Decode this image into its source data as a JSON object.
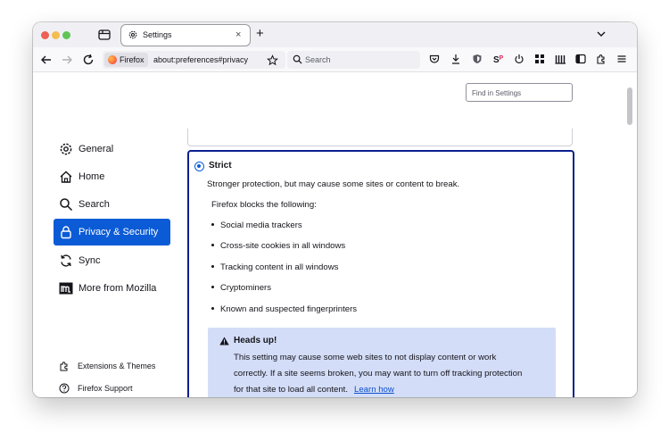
{
  "tab": {
    "title": "Settings",
    "close": "×"
  },
  "newtab_label": "+",
  "urlbar": {
    "identity": "Firefox",
    "url": "about:preferences#privacy"
  },
  "searchbar": {
    "placeholder": "Search"
  },
  "find": {
    "placeholder": "Find in Settings"
  },
  "sidebar": {
    "items": [
      {
        "label": "General",
        "icon": "gear-icon"
      },
      {
        "label": "Home",
        "icon": "home-icon"
      },
      {
        "label": "Search",
        "icon": "search-icon"
      },
      {
        "label": "Privacy & Security",
        "icon": "lock-icon",
        "selected": true
      },
      {
        "label": "Sync",
        "icon": "sync-icon"
      },
      {
        "label": "More from Mozilla",
        "icon": "mozilla-icon"
      }
    ],
    "footer": [
      {
        "label": "Extensions & Themes",
        "icon": "puzzle-icon"
      },
      {
        "label": "Firefox Support",
        "icon": "help-icon"
      }
    ]
  },
  "strict": {
    "title": "Strict",
    "description": "Stronger protection, but may cause some sites or content to break.",
    "blocks_heading": "Firefox blocks the following:",
    "blocks": [
      "Social media trackers",
      "Cross-site cookies in all windows",
      "Tracking content in all windows",
      "Cryptominers",
      "Known and suspected fingerprinters"
    ],
    "headsup": {
      "title": "Heads up!",
      "lines": [
        "This setting may cause some web sites to not display content or work",
        "correctly. If a site seems broken, you may want to turn off tracking protection",
        "for that site to load all content."
      ],
      "link": "Learn how"
    }
  },
  "colors": {
    "accent": "#0b5bd6",
    "selected_border": "#0c1f8e",
    "headsup_bg": "#d3ddf7"
  }
}
